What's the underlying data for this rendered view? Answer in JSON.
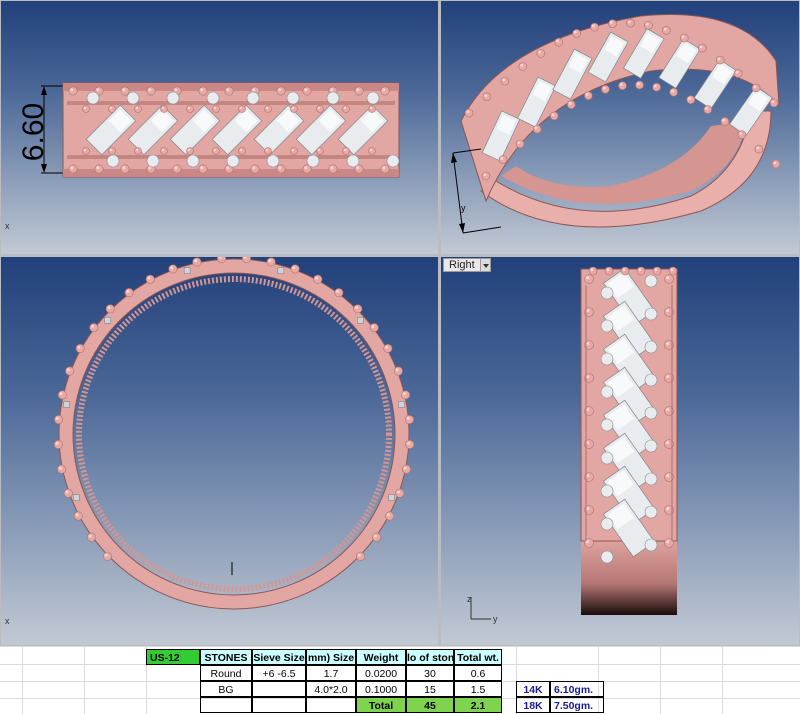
{
  "viewports": {
    "top_right_label": "Right",
    "dimension_value": "6.60",
    "axes": {
      "x": "x",
      "y": "y",
      "z": "z"
    }
  },
  "table": {
    "headers": {
      "ring_size": "US-12",
      "stones": "STONES",
      "sieve": "Sieve Size",
      "mm_size": "mm) Size",
      "weight": "Weight",
      "no_stones": "lo of stone",
      "total_wt": "Total wt."
    },
    "rows": [
      {
        "stone": "Round",
        "sieve": "+6 -6.5",
        "mm": "1.7",
        "weight": "0.0200",
        "count": "30",
        "total": "0.6"
      },
      {
        "stone": "BG",
        "sieve": "",
        "mm": "4.0*2.0",
        "weight": "0.1000",
        "count": "15",
        "total": "1.5"
      }
    ],
    "total_label": "Total",
    "total_count": "45",
    "total_weight": "2.1",
    "metals": [
      {
        "karat": "14K",
        "gold_weight": "6.10gm."
      },
      {
        "karat": "18K",
        "gold_weight": "7.50gm."
      }
    ]
  },
  "colors": {
    "metal": "#e7a9a5",
    "metal_dark": "#b06f6c",
    "stone": "#e8ecef",
    "bg_top": "#22407a",
    "bg_bottom": "#c2c9d3"
  }
}
